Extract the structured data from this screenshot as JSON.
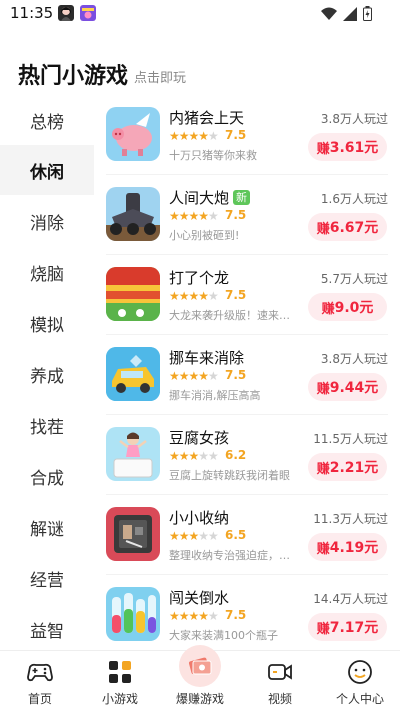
{
  "status_bar": {
    "time": "11:35"
  },
  "header": {
    "title": "热门小游戏",
    "subtitle": "点击即玩"
  },
  "categories": [
    {
      "label": "总榜",
      "active": false
    },
    {
      "label": "休闲",
      "active": true
    },
    {
      "label": "消除",
      "active": false
    },
    {
      "label": "烧脑",
      "active": false
    },
    {
      "label": "模拟",
      "active": false
    },
    {
      "label": "养成",
      "active": false
    },
    {
      "label": "找茬",
      "active": false
    },
    {
      "label": "合成",
      "active": false
    },
    {
      "label": "解谜",
      "active": false
    },
    {
      "label": "经营",
      "active": false
    },
    {
      "label": "益智",
      "active": false
    }
  ],
  "games": [
    {
      "name": "内猪会上天",
      "badge": "",
      "rating": "7.5",
      "desc": "十万只猪等你来救",
      "players": "3.8万人玩过",
      "earn_prefix": "赚",
      "earn_amount": "3.61元",
      "icon": "pig-game-icon"
    },
    {
      "name": "人间大炮",
      "badge": "新",
      "rating": "7.5",
      "desc": "小心别被砸到!",
      "players": "1.6万人玩过",
      "earn_prefix": "赚",
      "earn_amount": "6.67元",
      "icon": "cannon-game-icon"
    },
    {
      "name": "打了个龙",
      "badge": "",
      "rating": "7.5",
      "desc": "大龙来袭升级版！速来挑战！",
      "players": "5.7万人玩过",
      "earn_prefix": "赚",
      "earn_amount": "9.0元",
      "icon": "dragon-game-icon"
    },
    {
      "name": "挪车来消除",
      "badge": "",
      "rating": "7.5",
      "desc": "挪车消消,解压高高",
      "players": "3.8万人玩过",
      "earn_prefix": "赚",
      "earn_amount": "9.44元",
      "icon": "car-game-icon"
    },
    {
      "name": "豆腐女孩",
      "badge": "",
      "rating": "6.2",
      "desc": "豆腐上旋转跳跃我闭着眼",
      "players": "11.5万人玩过",
      "earn_prefix": "赚",
      "earn_amount": "2.21元",
      "icon": "tofu-girl-game-icon"
    },
    {
      "name": "小小收纳",
      "badge": "",
      "rating": "6.5",
      "desc": "整理收纳专治强迫症，超解压",
      "players": "11.3万人玩过",
      "earn_prefix": "赚",
      "earn_amount": "4.19元",
      "icon": "storage-game-icon"
    },
    {
      "name": "闯关倒水",
      "badge": "",
      "rating": "7.5",
      "desc": "大家来装满100个瓶子",
      "players": "14.4万人玩过",
      "earn_prefix": "赚",
      "earn_amount": "7.17元",
      "icon": "water-sort-game-icon"
    }
  ],
  "bottom_nav": [
    {
      "label": "首页",
      "icon": "gamepad-icon"
    },
    {
      "label": "小游戏",
      "icon": "grid-icon"
    },
    {
      "label": "爆赚游戏",
      "icon": "money-icon"
    },
    {
      "label": "视频",
      "icon": "video-icon"
    },
    {
      "label": "个人中心",
      "icon": "smiley-icon"
    }
  ],
  "colors": {
    "accent": "#f0263e",
    "earn_bg": "#fdecee",
    "star": "#f3a522",
    "new_badge": "#5ec65a",
    "active_category_bg": "#f4f4f4"
  }
}
